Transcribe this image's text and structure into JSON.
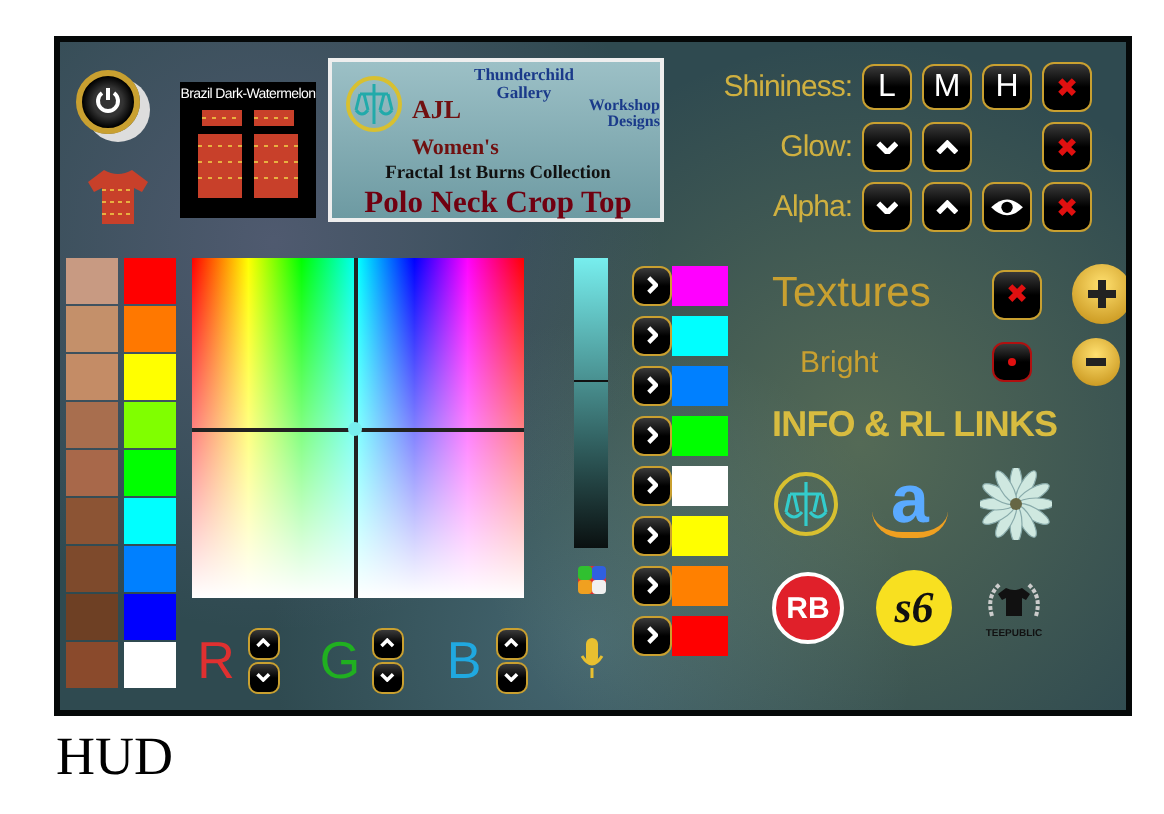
{
  "thumbnail": {
    "caption": "Brazil Dark-Watermelon"
  },
  "title_card": {
    "gallery_lines": [
      "Thunderchild",
      "Gallery"
    ],
    "brand": "AJL",
    "studio_lines": [
      "Workshop",
      "Designs"
    ],
    "audience": "Women's",
    "collection": "Fractal 1st Burns Collection",
    "product": "Polo Neck Crop Top"
  },
  "settings": [
    {
      "label": "Shininess:",
      "buttons": [
        {
          "kind": "text",
          "text": "L"
        },
        {
          "kind": "text",
          "text": "M"
        },
        {
          "kind": "text",
          "text": "H"
        },
        {
          "kind": "reset"
        }
      ]
    },
    {
      "label": "Glow:",
      "buttons": [
        {
          "kind": "down"
        },
        {
          "kind": "up"
        },
        {
          "kind": "blank"
        },
        {
          "kind": "reset"
        }
      ]
    },
    {
      "label": "Alpha:",
      "buttons": [
        {
          "kind": "down"
        },
        {
          "kind": "up"
        },
        {
          "kind": "eye"
        },
        {
          "kind": "reset"
        }
      ]
    }
  ],
  "skin_swatches": [
    {
      "color": "#c89a82"
    },
    {
      "color": "#c4906a"
    },
    {
      "color": "#c48c66"
    },
    {
      "color": "#a86e4e"
    },
    {
      "color": "#a8684a"
    },
    {
      "color": "#8c5434"
    },
    {
      "color": "#7e4a2c"
    },
    {
      "color": "#6e4024"
    },
    {
      "color": "#8a4a2c"
    }
  ],
  "bright_swatches": [
    {
      "color": "#ff0000"
    },
    {
      "color": "#ff7800"
    },
    {
      "color": "#ffff00"
    },
    {
      "color": "#80ff00"
    },
    {
      "color": "#00ff00"
    },
    {
      "color": "#00ffff"
    },
    {
      "color": "#0080ff"
    },
    {
      "color": "#0000ff"
    },
    {
      "color": "#ffffff"
    }
  ],
  "brightness": {
    "level": 0.57
  },
  "rgb": [
    {
      "label": "R",
      "color": "#e03030"
    },
    {
      "label": "G",
      "color": "#20b020"
    },
    {
      "label": "B",
      "color": "#20a8e0"
    }
  ],
  "palette": [
    {
      "color": "#ff00ff"
    },
    {
      "color": "#00ffff"
    },
    {
      "color": "#0080ff"
    },
    {
      "color": "#00ff00"
    },
    {
      "color": "#ffffff"
    },
    {
      "color": "#ffff00"
    },
    {
      "color": "#ff8000"
    },
    {
      "color": "#ff0000"
    }
  ],
  "textures": {
    "label": "Textures"
  },
  "bright": {
    "label": "Bright"
  },
  "links_heading": "INFO & RL LINKS",
  "links": [
    {
      "kind": "ajl"
    },
    {
      "kind": "amazon",
      "text": "a"
    },
    {
      "kind": "flower"
    },
    {
      "kind": "rb",
      "text": "RB"
    },
    {
      "kind": "s6",
      "text": "s6"
    },
    {
      "kind": "teepublic",
      "text": "TEEPUBLIC"
    }
  ],
  "caption": "HUD"
}
